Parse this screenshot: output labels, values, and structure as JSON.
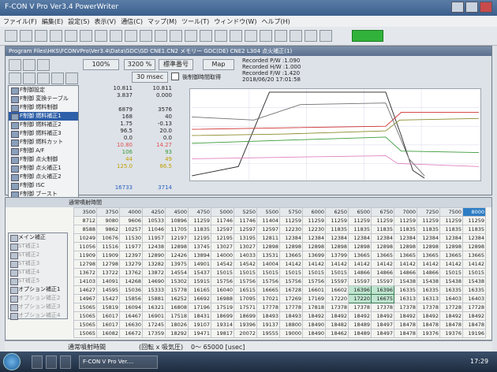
{
  "window": {
    "title": "F-CON V Pro Ver3.4 PowerWriter"
  },
  "menu": [
    "ファイル(F)",
    "編集(E)",
    "設定(S)",
    "表示(V)",
    "通信(C)",
    "マップ(M)",
    "ツール(T)",
    "ウィンドウ(W)",
    "ヘルプ(H)"
  ],
  "subwindow": {
    "title": "Program Files\\HKS\\FCONVPro\\Ver3.4\\Data\\GDC\\GD CNE1.CN2 メモリー GDC(DE) CNE2 L304 点火補正(1)"
  },
  "toolbar2": {
    "zoom_a": "100%",
    "zoom_b": "3200 %",
    "btn_a": "標準番号",
    "btn_b": "Map",
    "interval": "30 msec",
    "check_label": "後制御時間取得"
  },
  "recorded": {
    "pw": "Recorded P/W :1.090",
    "hw": "Recorded H/W :1.000",
    "fw": "Recorded F/W :1.420",
    "date": "2018/06/20 17:01:58"
  },
  "side_items": [
    "F制御設定",
    "F制御 変換テーブル",
    "F制御 燃料制御",
    "F制御 燃料補正1",
    "F制御 燃料補正2",
    "F制御 燃料補正3",
    "F制御 燃料カット",
    "F制御 A/F",
    "F制御 点火制御",
    "F制御 点火補正1",
    "F制御 点火補正2",
    "F制御 ISC",
    "F制御 ブースト",
    "F制御 パルタイ",
    "F制御 オプション出力"
  ],
  "value_rows": [
    [
      "10.811",
      "10.811"
    ],
    [
      "3.837",
      "0.000"
    ],
    [
      "",
      ""
    ],
    [
      "6879",
      "3576"
    ],
    [
      "168",
      "40"
    ],
    [
      "1.75",
      "-0.13"
    ],
    [
      "96.5",
      "20.0"
    ],
    [
      "0.0",
      "0.0"
    ],
    [
      "10.80",
      "14.27"
    ],
    [
      "106",
      "93"
    ],
    [
      "44",
      "49"
    ],
    [
      "125.0",
      "86.5"
    ],
    [
      "",
      ""
    ],
    [
      "",
      ""
    ],
    [
      "16733",
      "3714"
    ]
  ],
  "grid": {
    "title": "通常噴射時間",
    "headers": [
      "3500",
      "3750",
      "4000",
      "4250",
      "4500",
      "4750",
      "5000",
      "5250",
      "5500",
      "5750",
      "6000",
      "6250",
      "6500",
      "6750",
      "7000",
      "7250",
      "7500",
      "8000"
    ],
    "rows": [
      [
        "8712",
        "9080",
        "9606",
        "10533",
        "10896",
        "11259",
        "11746",
        "11746",
        "11404",
        "11259",
        "11259",
        "11259",
        "11259",
        "11259",
        "11259",
        "11259",
        "11259",
        "11259"
      ],
      [
        "8588",
        "9862",
        "10257",
        "11046",
        "11705",
        "11835",
        "12597",
        "12597",
        "12597",
        "12230",
        "12230",
        "11835",
        "11835",
        "11835",
        "11835",
        "11835",
        "11835",
        "11835"
      ],
      [
        "10249",
        "10676",
        "11530",
        "11957",
        "12197",
        "12195",
        "12195",
        "13195",
        "12811",
        "12384",
        "12384",
        "12384",
        "12384",
        "12384",
        "12384",
        "12384",
        "12384",
        "12384"
      ],
      [
        "11056",
        "11516",
        "11977",
        "12438",
        "12898",
        "13745",
        "13027",
        "13027",
        "12898",
        "12898",
        "12898",
        "12898",
        "12898",
        "12898",
        "12898",
        "12898",
        "12898",
        "12898"
      ],
      [
        "11909",
        "11909",
        "12397",
        "12890",
        "12426",
        "13894",
        "14000",
        "14033",
        "13531",
        "13665",
        "13699",
        "13799",
        "13665",
        "13665",
        "13665",
        "13665",
        "13665",
        "13665"
      ],
      [
        "12798",
        "12798",
        "13279",
        "13282",
        "13975",
        "14901",
        "14542",
        "14542",
        "14004",
        "14142",
        "14142",
        "14142",
        "14142",
        "14142",
        "14142",
        "14142",
        "14142",
        "14142"
      ],
      [
        "13672",
        "13722",
        "13762",
        "13872",
        "14554",
        "15437",
        "15015",
        "15015",
        "15015",
        "15015",
        "15015",
        "15015",
        "14866",
        "14866",
        "14866",
        "14866",
        "15015",
        "15015"
      ],
      [
        "14103",
        "14091",
        "14268",
        "14690",
        "15302",
        "15915",
        "15756",
        "15756",
        "15756",
        "15756",
        "15756",
        "15597",
        "15597",
        "15597",
        "15438",
        "15438",
        "15438",
        "15438"
      ],
      [
        "14627",
        "14595",
        "15036",
        "15333",
        "15778",
        "16165",
        "16040",
        "16515",
        "16665",
        "16728",
        "16601",
        "16602",
        "16396",
        "16396",
        "16335",
        "16335",
        "16335",
        "16335"
      ],
      [
        "14967",
        "15427",
        "15856",
        "15881",
        "16252",
        "16692",
        "16988",
        "17095",
        "17021",
        "17269",
        "17169",
        "17220",
        "17220",
        "16675",
        "16313",
        "16313",
        "16403",
        "16403"
      ],
      [
        "15065",
        "15819",
        "16094",
        "16321",
        "16808",
        "17196",
        "17519",
        "17571",
        "17778",
        "17778",
        "17818",
        "17378",
        "17378",
        "17378",
        "17378",
        "17378",
        "17728",
        "17728"
      ],
      [
        "15065",
        "16017",
        "16467",
        "16901",
        "17518",
        "18431",
        "18699",
        "18699",
        "18493",
        "18493",
        "18492",
        "18492",
        "18492",
        "18492",
        "18492",
        "18492",
        "18492",
        "18492"
      ],
      [
        "15065",
        "16017",
        "16630",
        "17245",
        "18026",
        "19107",
        "19314",
        "19396",
        "19137",
        "18800",
        "18490",
        "18482",
        "18489",
        "18497",
        "18478",
        "18478",
        "18478",
        "18478"
      ],
      [
        "15065",
        "16082",
        "16672",
        "17359",
        "18292",
        "19471",
        "19817",
        "20072",
        "19555",
        "19000",
        "18490",
        "18462",
        "18489",
        "18497",
        "18478",
        "19376",
        "19376",
        "19196"
      ]
    ]
  },
  "lower_items": [
    "メイン補正",
    "ST補正1",
    "ST補正2",
    "ST補正3",
    "ST補正4",
    "ST補正5",
    "オプション補正1",
    "オプション補正2",
    "オプション補正3",
    "オプション補正4"
  ],
  "status": {
    "left": "通常噴射時間",
    "mid": "(回転 x 吸気圧)",
    "range": "0〜 65000 [usec]"
  },
  "taskbar": {
    "app": "F-CON V Pro Ver....",
    "time": "17:29"
  },
  "colors": {
    "title": "#3b5f8c",
    "accent_green": "#31b33b",
    "selected": "#2e5fa8"
  }
}
